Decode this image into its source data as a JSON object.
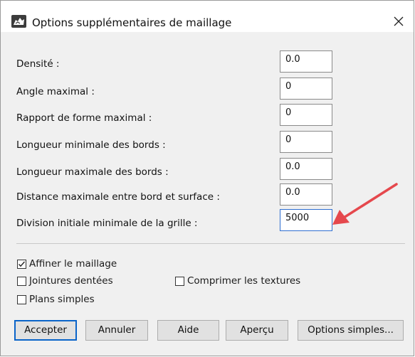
{
  "window": {
    "title": "Options supplémentaires de maillage",
    "icon": "rhino-app-icon",
    "close_icon": "close-icon"
  },
  "fields": [
    {
      "label": "Densité :",
      "value": "0.0"
    },
    {
      "label": "Angle maximal :",
      "value": "0"
    },
    {
      "label": "Rapport de forme maximal :",
      "value": "0"
    },
    {
      "label": "Longueur minimale des bords :",
      "value": "0"
    },
    {
      "label": "Longueur maximale des bords :",
      "value": "0.0"
    },
    {
      "label": "Distance maximale entre bord et surface :",
      "value": "0.0"
    },
    {
      "label": "Division initiale minimale de la grille :",
      "value": "5000"
    }
  ],
  "checkboxes": [
    {
      "label": "Affiner le maillage",
      "checked": true
    },
    {
      "label": "Jointures dentées",
      "checked": false
    },
    {
      "label": "Comprimer les textures",
      "checked": false
    },
    {
      "label": "Plans simples",
      "checked": false
    }
  ],
  "buttons": {
    "accept": "Accepter",
    "cancel": "Annuler",
    "help": "Aide",
    "preview": "Aperçu",
    "simple_options": "Options simples..."
  },
  "colors": {
    "arrow": "#e5484d",
    "focus_border": "#0a64c9"
  }
}
